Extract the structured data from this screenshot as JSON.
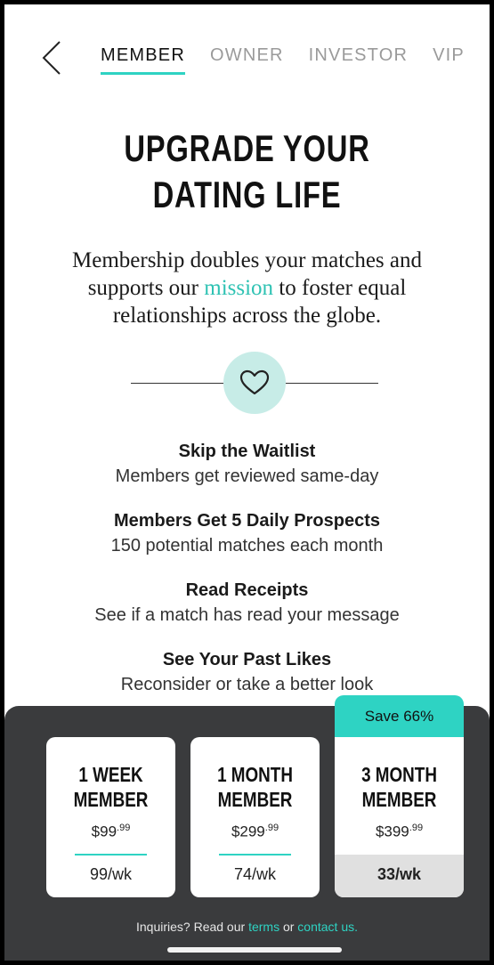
{
  "nav": {
    "tabs": [
      {
        "label": "MEMBER",
        "active": true
      },
      {
        "label": "OWNER",
        "active": false
      },
      {
        "label": "INVESTOR",
        "active": false
      },
      {
        "label": "VIP",
        "active": false
      }
    ]
  },
  "headline": {
    "line1": "UPGRADE YOUR",
    "line2": "DATING LIFE"
  },
  "intro": {
    "before": "Membership doubles your matches and supports our ",
    "link": "mission",
    "after": " to foster equal relationships across the globe."
  },
  "features": [
    {
      "title": "Skip the Waitlist",
      "desc": "Members get reviewed same-day"
    },
    {
      "title": "Members Get 5 Daily Prospects",
      "desc": "150 potential matches each month"
    },
    {
      "title": "Read Receipts",
      "desc": "See if a match has read your message"
    },
    {
      "title": "See Your Past Likes",
      "desc": "Reconsider or take a better look"
    }
  ],
  "plans": [
    {
      "line1": "1 WEEK",
      "line2": "MEMBER",
      "price_main": "$99",
      "price_cents": ".99",
      "per": "99/wk"
    },
    {
      "line1": "1 MONTH",
      "line2": "MEMBER",
      "price_main": "$299",
      "price_cents": ".99",
      "per": "74/wk"
    },
    {
      "line1": "3 MONTH",
      "line2": "MEMBER",
      "price_main": "$399",
      "price_cents": ".99",
      "per": "33/wk",
      "badge": "Save 66%"
    }
  ],
  "footer": {
    "prefix": "Inquiries? Read our ",
    "terms": "terms",
    "mid": " or ",
    "contact": "contact us."
  },
  "colors": {
    "accent": "#2ed3c3",
    "sheet": "#3a3b3d",
    "heart_bg": "#c7ece7"
  },
  "icons": {
    "back": "chevron-left-icon",
    "heart": "heart-icon"
  }
}
